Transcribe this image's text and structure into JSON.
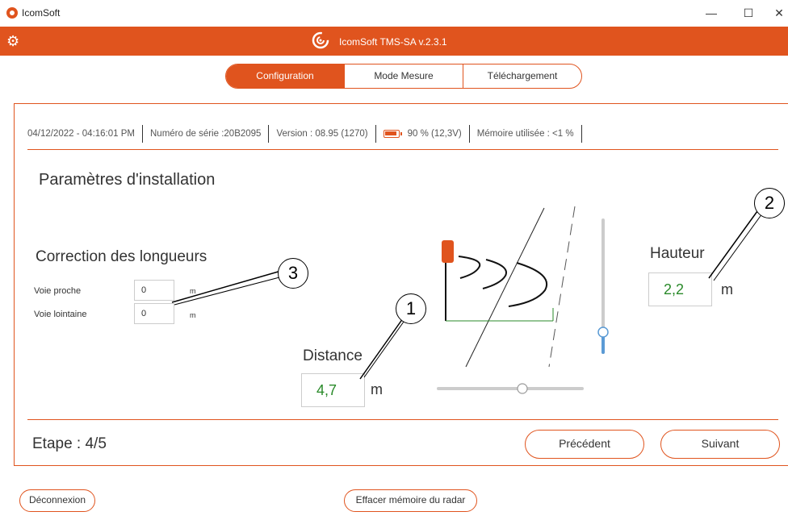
{
  "window": {
    "title": "IcomSoft",
    "minimize": "—",
    "maximize": "☐",
    "close": "✕"
  },
  "header": {
    "app_title": "IcomSoft TMS-SA  v.2.3.1",
    "accent": "#e0541e"
  },
  "tabs": [
    {
      "label": "Configuration",
      "active": true
    },
    {
      "label": "Mode Mesure",
      "active": false
    },
    {
      "label": "Téléchargement",
      "active": false
    }
  ],
  "info": {
    "datetime": "04/12/2022 - 04:16:01 PM",
    "serial": "Numéro de série :20B2095",
    "version": "Version : 08.95 (1270)",
    "battery": "90 %  (12,3V)",
    "battery_level": 0.9,
    "memory": "Mémoire utilisée : <1 %"
  },
  "section_title": "Paramètres d'installation",
  "correction": {
    "title": "Correction des longueurs",
    "near_label": "Voie proche",
    "near_value": "0",
    "far_label": "Voie lointaine",
    "far_value": "0",
    "unit": "m"
  },
  "distance": {
    "label": "Distance",
    "value": "4,7",
    "unit": "m"
  },
  "hauteur": {
    "label": "Hauteur",
    "value": "2,2",
    "unit": "m"
  },
  "callouts": {
    "one": "1",
    "two": "2",
    "three": "3"
  },
  "step": "Etape : 4/5",
  "buttons": {
    "previous": "Précédent",
    "next": "Suivant",
    "disconnect": "Déconnexion",
    "clear_memory": "Effacer mémoire du radar"
  },
  "value_color": "#2a8a2a"
}
